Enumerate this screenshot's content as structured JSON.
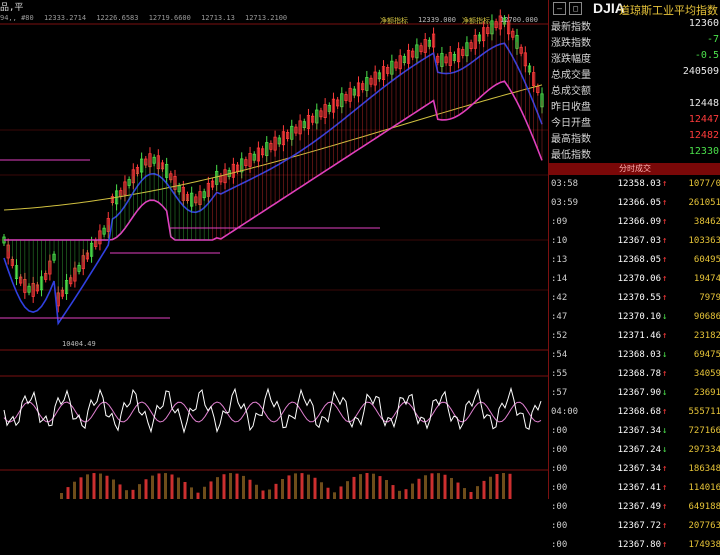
{
  "window": {
    "corner_label": "品,平"
  },
  "chart": {
    "info_bar": [
      "94,, #80",
      "12333.2714",
      "12226.6583",
      "12719.6600",
      "12713.13",
      "12713.2100"
    ],
    "low_label": "10404.49",
    "high_label_1": "净额指标",
    "high_label_2": "12339.000",
    "high_label_3": "净额指标",
    "high_label_4": "12700.000",
    "colors": {
      "up": "#ff3b3b",
      "down": "#4be04b",
      "ma_magenta": "#e040c0",
      "ma_blue": "#3040e0",
      "ma_yellow": "#d0c040",
      "grid": "#7a1010",
      "osc_white": "#ffffff",
      "osc_pink": "#e080d0"
    }
  },
  "header": {
    "code": "DJIA",
    "name": "道琼斯工业平均指数",
    "icons": [
      "minimize-icon",
      "expand-icon"
    ]
  },
  "stats": [
    {
      "label": "最新指数",
      "value": "12360",
      "color": "#e8e8e8"
    },
    {
      "label": "涨跌指数",
      "value": "-7",
      "color": "#4be04b"
    },
    {
      "label": "涨跌幅度",
      "value": "-0.5",
      "color": "#4be04b"
    },
    {
      "label": "总成交量",
      "value": "240509",
      "color": "#e8e8e8"
    },
    {
      "label": "总成交额",
      "value": "",
      "color": "#e8e8e8"
    },
    {
      "label": "昨日收盘",
      "value": "12448",
      "color": "#e8e8e8"
    },
    {
      "label": "今日开盘",
      "value": "12447",
      "color": "#ff3b3b"
    },
    {
      "label": "最高指数",
      "value": "12482",
      "color": "#ff3b3b"
    },
    {
      "label": "最低指数",
      "value": "12330",
      "color": "#4be04b"
    }
  ],
  "ticks_title": "分时成交",
  "ticks": [
    {
      "time": "03:58",
      "price": "12358.03",
      "dir": "up",
      "vol": "1077/0"
    },
    {
      "time": "03:59",
      "price": "12366.05",
      "dir": "up",
      "vol": "261051"
    },
    {
      "time": ":09",
      "price": "12366.09",
      "dir": "up",
      "vol": "38462"
    },
    {
      "time": ":10",
      "price": "12367.03",
      "dir": "up",
      "vol": "103363"
    },
    {
      "time": ":13",
      "price": "12368.05",
      "dir": "up",
      "vol": "60495"
    },
    {
      "time": ":14",
      "price": "12370.06",
      "dir": "up",
      "vol": "19474"
    },
    {
      "time": ":42",
      "price": "12370.55",
      "dir": "up",
      "vol": "7979"
    },
    {
      "time": ":47",
      "price": "12370.10",
      "dir": "down",
      "vol": "90686"
    },
    {
      "time": ":52",
      "price": "12371.46",
      "dir": "up",
      "vol": "23182"
    },
    {
      "time": ":54",
      "price": "12368.03",
      "dir": "down",
      "vol": "69475"
    },
    {
      "time": ":55",
      "price": "12368.78",
      "dir": "up",
      "vol": "34059"
    },
    {
      "time": ":57",
      "price": "12367.90",
      "dir": "down",
      "vol": "23691"
    },
    {
      "time": "04:00",
      "price": "12368.68",
      "dir": "up",
      "vol": "555711"
    },
    {
      "time": ":00",
      "price": "12367.34",
      "dir": "down",
      "vol": "727166"
    },
    {
      "time": ":00",
      "price": "12367.24",
      "dir": "down",
      "vol": "297334"
    },
    {
      "time": ":00",
      "price": "12367.34",
      "dir": "up",
      "vol": "186348"
    },
    {
      "time": ":00",
      "price": "12367.41",
      "dir": "up",
      "vol": "114016"
    },
    {
      "time": ":00",
      "price": "12367.49",
      "dir": "up",
      "vol": "649188"
    },
    {
      "time": ":00",
      "price": "12367.72",
      "dir": "up",
      "vol": "207763"
    },
    {
      "time": ":00",
      "price": "12367.80",
      "dir": "up",
      "vol": "174938"
    }
  ]
}
